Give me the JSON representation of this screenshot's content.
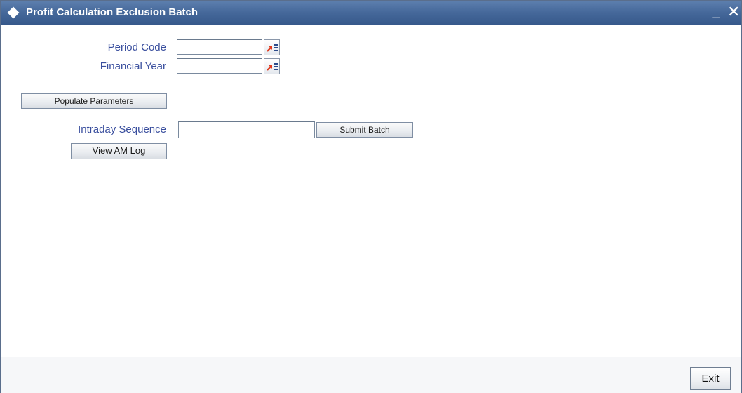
{
  "window": {
    "title": "Profit Calculation Exclusion Batch",
    "minimize_glyph": "_",
    "close_glyph": "✕"
  },
  "form": {
    "period_code": {
      "label": "Period Code",
      "value": ""
    },
    "financial_year": {
      "label": "Financial Year",
      "value": ""
    },
    "populate_parameters_label": "Populate Parameters",
    "intraday_sequence": {
      "label": "Intraday Sequence",
      "value": ""
    },
    "submit_batch_label": "Submit Batch",
    "view_am_log_label": "View AM Log"
  },
  "footer": {
    "exit_label": "Exit"
  },
  "icons": {
    "lov": "list-of-values-icon"
  },
  "colors": {
    "titlebar": "#45689a",
    "label_text": "#3a4f9e",
    "lov_arrow": "#e03a1e",
    "lov_lines": "#2b4a8a"
  }
}
